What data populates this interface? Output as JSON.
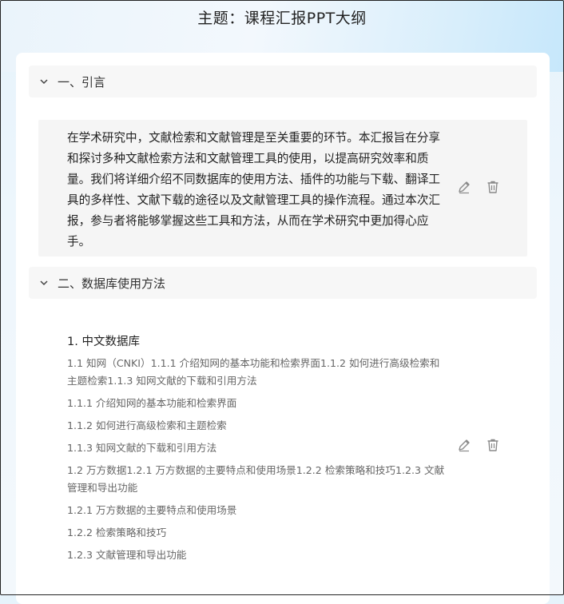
{
  "page": {
    "title": "主题：课程汇报PPT大纲"
  },
  "sections": [
    {
      "title": "一、引言",
      "content": "在学术研究中，文献检索和文献管理是至关重要的环节。本汇报旨在分享和探讨多种文献检索方法和文献管理工具的使用，以提高研究效率和质量。我们将详细介绍不同数据库的使用方法、插件的功能与下载、翻译工具的多样性、文献下载的途径以及文献管理工具的操作流程。通过本次汇报，参与者将能够掌握这些工具和方法，从而在学术研究中更加得心应手。"
    },
    {
      "title": "二、数据库使用方法",
      "subheading": "1. 中文数据库",
      "items": [
        "1.1 知网（CNKI）1.1.1 介绍知网的基本功能和检索界面1.1.2 如何进行高级检索和主题检索1.1.3 知网文献的下载和引用方法",
        "1.1.1 介绍知网的基本功能和检索界面",
        "1.1.2 如何进行高级检索和主题检索",
        "1.1.3 知网文献的下载和引用方法",
        "1.2 万方数据1.2.1 万方数据的主要特点和使用场景1.2.2 检索策略和技巧1.2.3 文献管理和导出功能",
        "1.2.1 万方数据的主要特点和使用场景",
        "1.2.2 检索策略和技巧",
        "1.2.3 文献管理和导出功能"
      ]
    }
  ],
  "icons": {
    "chevron": "chevron-down-icon",
    "edit": "pencil-icon",
    "delete": "trash-icon"
  },
  "colors": {
    "header_bg": "#f7f7f7",
    "content_bg": "#f5f5f5",
    "icon_gray": "#8a8a8a"
  }
}
